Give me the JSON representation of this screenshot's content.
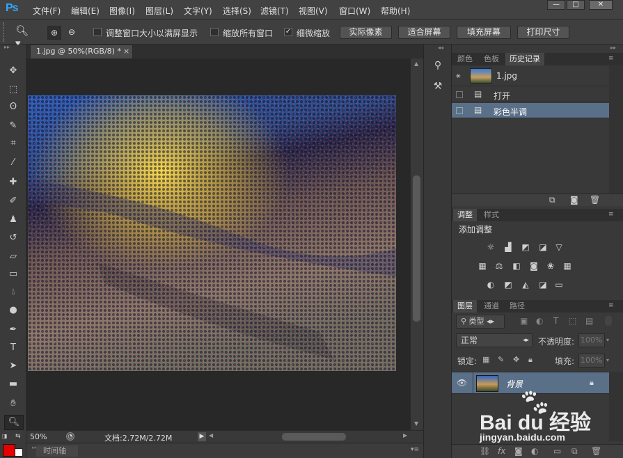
{
  "app": {
    "logo": "Ps"
  },
  "menu": [
    "文件(F)",
    "编辑(E)",
    "图像(I)",
    "图层(L)",
    "文字(Y)",
    "选择(S)",
    "滤镜(T)",
    "视图(V)",
    "窗口(W)",
    "帮助(H)"
  ],
  "options": {
    "resize_windows": "调整窗口大小以满屏显示",
    "zoom_all": "缩放所有窗口",
    "scrubby": "细微缩放",
    "actual_pixels": "实际像素",
    "fit_screen": "适合屏幕",
    "fill_screen": "填充屏幕",
    "print_size": "打印尺寸"
  },
  "document": {
    "tab_title": "1.jpg @ 50%(RGB/8) *",
    "close": "×"
  },
  "status": {
    "zoom": "50%",
    "doc_info": "文档:2.72M/2.72M"
  },
  "timeline": {
    "label": "时间轴"
  },
  "panels": {
    "history_tabs": [
      "颜色",
      "色板",
      "历史记录"
    ],
    "history": {
      "snapshot": "1.jpg",
      "steps": [
        "打开",
        "彩色半调"
      ]
    },
    "adjust_tabs": [
      "调整",
      "样式"
    ],
    "adjust_title": "添加调整",
    "layers_tabs": [
      "图层",
      "通道",
      "路径"
    ],
    "layers": {
      "kind": "类型",
      "blend": "正常",
      "opacity_label": "不透明度:",
      "opacity": "100%",
      "lock_label": "锁定:",
      "fill_label": "填充:",
      "fill": "100%",
      "layer_name": "背景"
    }
  },
  "watermark": {
    "brand": "Bai du 经验",
    "url": "jingyan.baidu.com"
  },
  "colors": {
    "foreground": "#e60000",
    "background": "#ffffff",
    "selection": "#5a6f88",
    "accent": "#31a8ff"
  }
}
